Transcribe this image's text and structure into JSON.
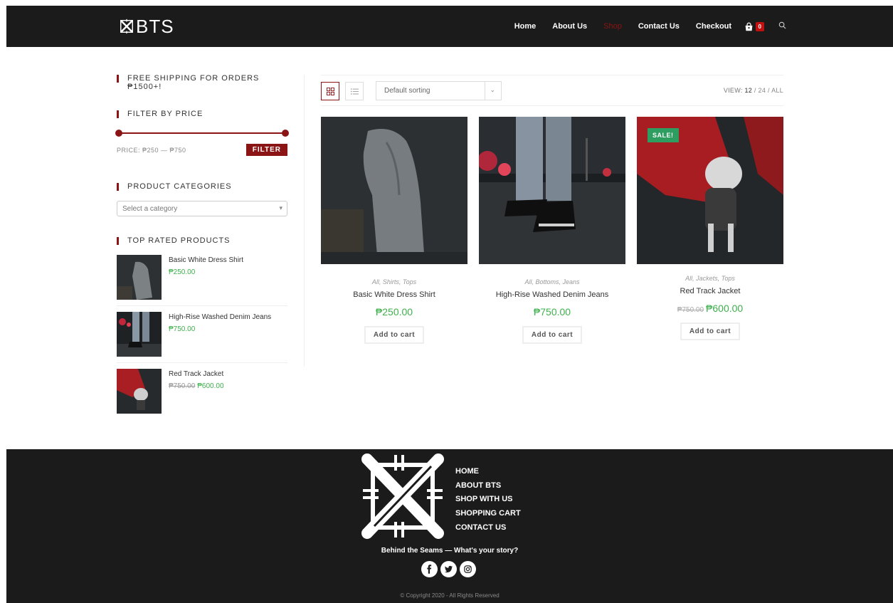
{
  "brand": {
    "name": "BTS"
  },
  "nav": {
    "items": [
      "Home",
      "About Us",
      "Shop",
      "Contact Us",
      "Checkout"
    ],
    "cart_count": "0"
  },
  "sidebar": {
    "shipping_title": "FREE SHIPPING FOR ORDERS ₱1500+!",
    "filter_title": "FILTER BY PRICE",
    "price_label": "PRICE: ₱250 — ₱750",
    "filter_button": "FILTER",
    "categories_title": "PRODUCT CATEGORIES",
    "category_placeholder": "Select a category",
    "top_rated_title": "TOP RATED PRODUCTS",
    "top_rated": [
      {
        "name": "Basic White Dress Shirt",
        "price": "₱250.00",
        "old_price": ""
      },
      {
        "name": "High-Rise Washed Denim Jeans",
        "price": "₱750.00",
        "old_price": ""
      },
      {
        "name": "Red Track Jacket",
        "price": "₱600.00",
        "old_price": "₱750.00"
      }
    ]
  },
  "toolbar": {
    "sort_label": "Default sorting",
    "view_label": "VIEW:",
    "view_options": [
      "12",
      "24",
      "ALL"
    ]
  },
  "products": [
    {
      "categories": "All, Shirts, Tops",
      "name": "Basic White Dress Shirt",
      "price": "₱250.00",
      "old_price": "",
      "button": "Add to cart"
    },
    {
      "categories": "All, Bottoms, Jeans",
      "name": "High-Rise Washed Denim Jeans",
      "price": "₱750.00",
      "old_price": "",
      "button": "Add to cart"
    },
    {
      "categories": "All, Jackets, Tops",
      "name": "Red Track Jacket",
      "price": "₱600.00",
      "old_price": "₱750.00",
      "button": "Add to cart",
      "badge": "SALE!"
    }
  ],
  "footer": {
    "menu": [
      "HOME",
      "ABOUT BTS",
      "SHOP WITH US",
      "SHOPPING CART",
      "CONTACT US"
    ],
    "tagline": "Behind the Seams — What's your story?",
    "copyright": "© Copyright 2020 - All Rights Reserved"
  },
  "colors": {
    "header_bg": "#1b1b1b",
    "accent": "#8b1414",
    "price_green": "#3fb04d",
    "sale_green": "#2d9e5f"
  }
}
